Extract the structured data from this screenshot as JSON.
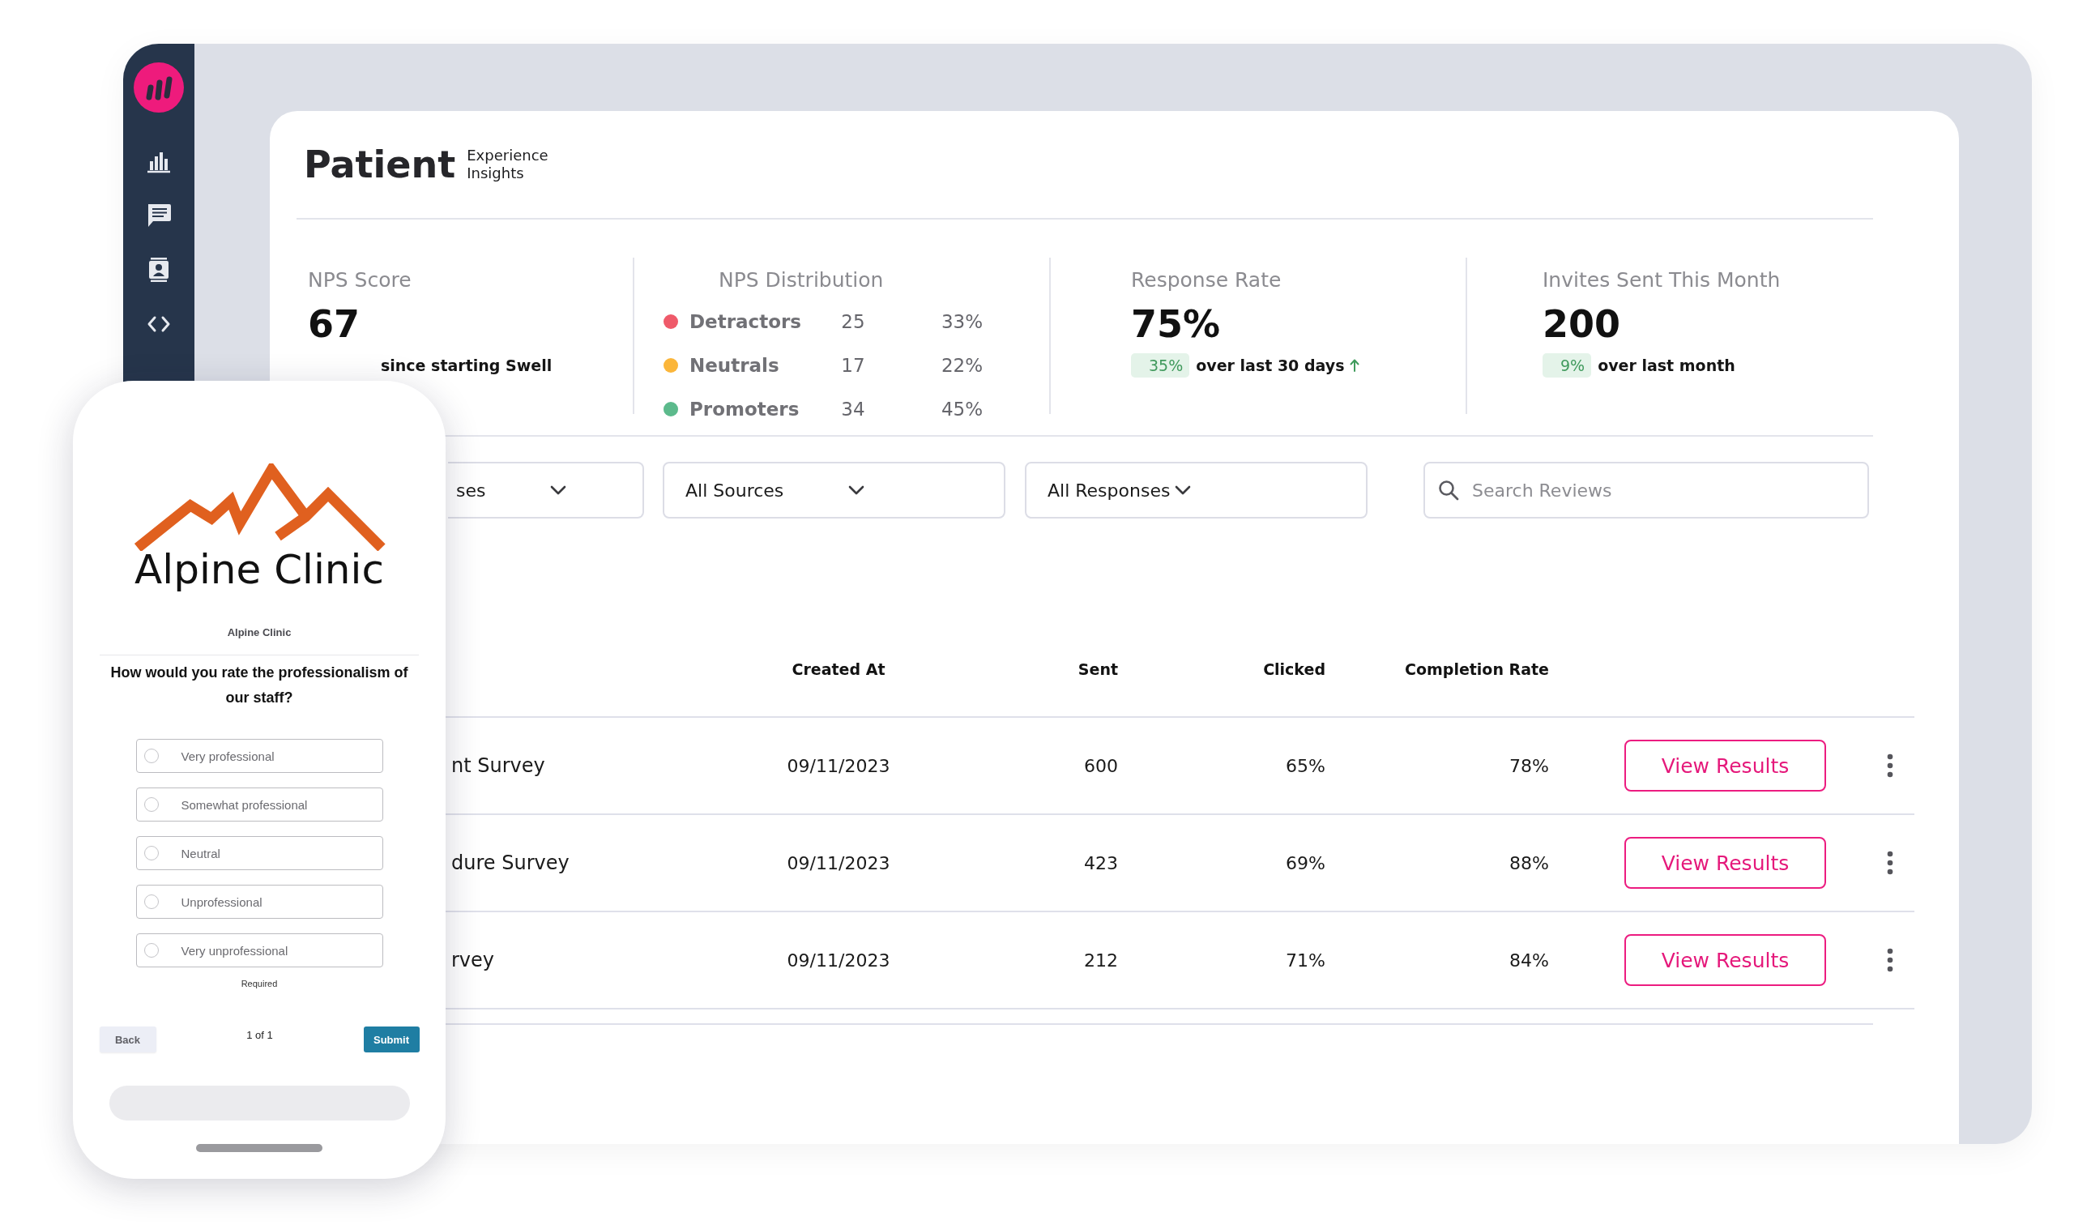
{
  "header": {
    "title": "Patient",
    "subtitle": "Experience Insights"
  },
  "stats": [
    {
      "kind": "score",
      "label": "NPS Score",
      "value": "67",
      "note": "since starting Swell"
    },
    {
      "kind": "distribution",
      "label": "NPS Distribution",
      "rows": [
        {
          "name": "Detractors",
          "color": "#ef5a6a",
          "count": "25",
          "percent": "33%"
        },
        {
          "name": "Neutrals",
          "color": "#fbb63a",
          "count": "17",
          "percent": "22%"
        },
        {
          "name": "Promoters",
          "color": "#5cba8c",
          "count": "34",
          "percent": "45%"
        }
      ]
    },
    {
      "kind": "metric",
      "label": "Response Rate",
      "value": "75%",
      "change": "35%",
      "note": "over last 30 days",
      "rising": true
    },
    {
      "kind": "metric",
      "label": "Invites Sent This Month",
      "value": "200",
      "change": "9%",
      "note": "over last month"
    }
  ],
  "filters": [
    {
      "kind": "dropdown",
      "value": "ses"
    },
    {
      "kind": "dropdown",
      "value": "All Sources"
    },
    {
      "kind": "dropdown",
      "value": "All Responses"
    },
    {
      "kind": "search",
      "placeholder": "Search Reviews"
    }
  ],
  "table": {
    "columns": [
      "Created At",
      "Sent",
      "Clicked",
      "Completion Rate"
    ],
    "rows": [
      {
        "name": "nt Survey",
        "created_at": "09/11/2023",
        "sent": "600",
        "clicked": "65%",
        "completion_rate": "78%",
        "action": "View Results"
      },
      {
        "name": "dure Survey",
        "created_at": "09/11/2023",
        "sent": "423",
        "clicked": "69%",
        "completion_rate": "88%",
        "action": "View Results"
      },
      {
        "name": "rvey",
        "created_at": "09/11/2023",
        "sent": "212",
        "clicked": "71%",
        "completion_rate": "84%",
        "action": "View Results"
      }
    ]
  },
  "phone": {
    "logo_text": "Alpine Clinic",
    "clinic_name": "Alpine Clinic",
    "question": "How would you rate the professionalism of our staff?",
    "options": [
      {
        "label": "Very professional",
        "selected": false
      },
      {
        "label": "Somewhat professional",
        "selected": false
      },
      {
        "label": "Neutral",
        "selected": false
      },
      {
        "label": "Unprofessional",
        "selected": false
      },
      {
        "label": "Very unprofessional",
        "selected": false
      }
    ],
    "required_note": "Required",
    "back_button": "Back",
    "page_indicator": "1 of 1",
    "submit_button": "Submit"
  }
}
